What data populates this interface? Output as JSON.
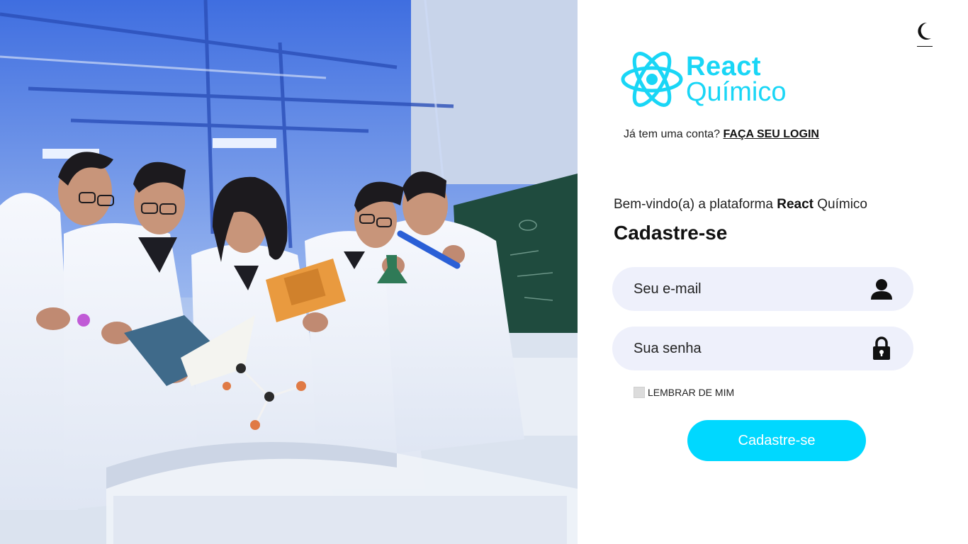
{
  "hero": {
    "image_description": "",
    "book_cover_text": ""
  },
  "theme_toggle": {
    "icon": "moon-icon"
  },
  "brand": {
    "line1": "React",
    "line2": "Químico",
    "color": "#19d6f6",
    "icon": "react-atom-logo-icon"
  },
  "login_prompt": {
    "text": "Já tem uma conta?",
    "link": "FAÇA SEU LOGIN"
  },
  "welcome": {
    "prefix": "Bem-vindo(a) a plataforma",
    "brand_bold": "React",
    "suffix": "Químico"
  },
  "page_title": "Cadastre-se",
  "form": {
    "email": {
      "placeholder": "Seu e-mail",
      "value": "",
      "icon": "user-icon"
    },
    "password": {
      "placeholder": "Sua senha",
      "value": "",
      "icon": "lock-icon"
    },
    "remember_label": "LEMBRAR DE MIM",
    "remember_checked": false,
    "submit_label": "Cadastre-se",
    "submit_color": "#00d8ff",
    "field_background": "#eef0fb"
  }
}
